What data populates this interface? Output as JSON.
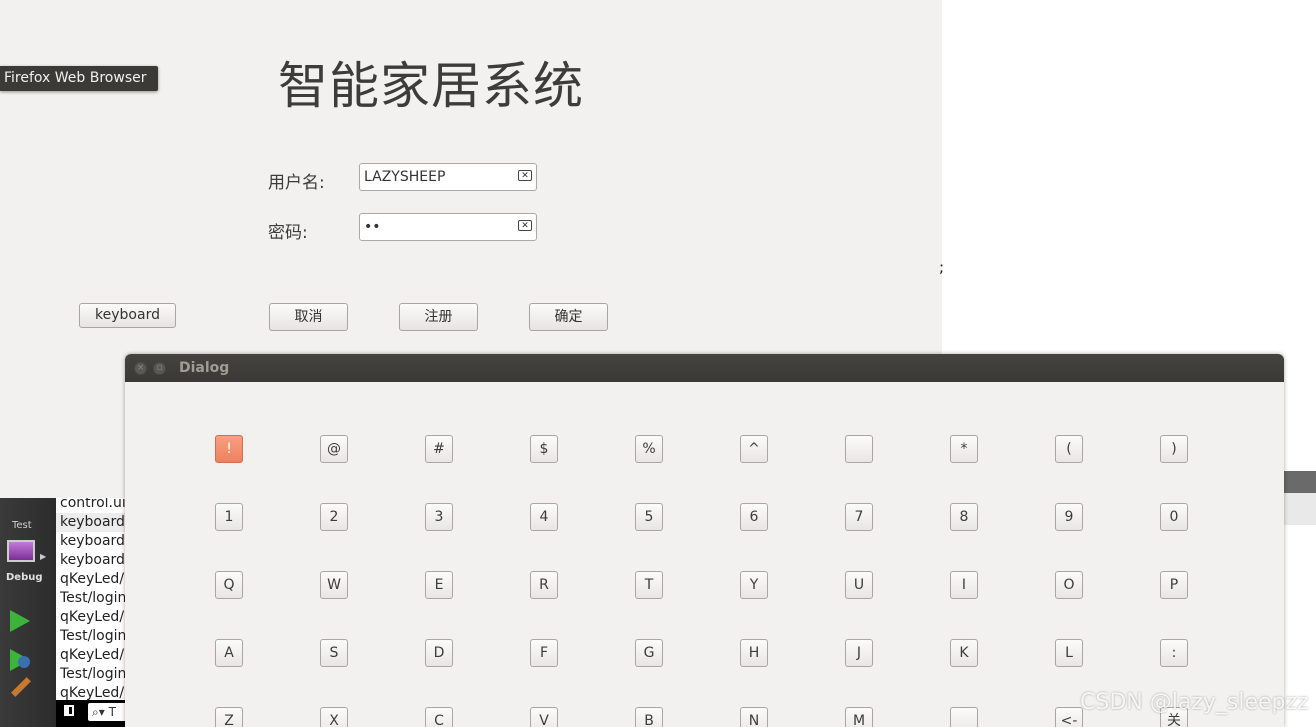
{
  "login": {
    "title": "智能家居系统",
    "username_label": "用户名:",
    "username_value": "LAZYSHEEP",
    "password_label": "密码:",
    "password_value": "••",
    "keyboard_button": "keyboard",
    "cancel_button": "取消",
    "register_button": "注册",
    "confirm_button": "确定"
  },
  "tooltip": "Firefox Web Browser",
  "stray_text": ";",
  "qt": {
    "kit_label": "Test",
    "mode_label": "Debug",
    "files": [
      "control.ui",
      "keyboard.",
      "keyboard.",
      "keyboard.",
      "qKeyLed/",
      "Test/login",
      "qKeyLed/",
      "Test/login",
      "qKeyLed/",
      "Test/login",
      "qKeyLed/"
    ],
    "search_placeholder": "T"
  },
  "dialog": {
    "title": "Dialog",
    "rows": [
      [
        "!",
        "@",
        "#",
        "$",
        "%",
        "^",
        "",
        "*",
        "(",
        ")"
      ],
      [
        "1",
        "2",
        "3",
        "4",
        "5",
        "6",
        "7",
        "8",
        "9",
        "0"
      ],
      [
        "Q",
        "W",
        "E",
        "R",
        "T",
        "Y",
        "U",
        "I",
        "O",
        "P"
      ],
      [
        "A",
        "S",
        "D",
        "F",
        "G",
        "H",
        "J",
        "K",
        "L",
        ":"
      ],
      [
        "Z",
        "X",
        "C",
        "V",
        "B",
        "N",
        "M",
        "",
        "<-",
        "关闭"
      ]
    ]
  },
  "watermark": "CSDN @lazy_sleepzz"
}
